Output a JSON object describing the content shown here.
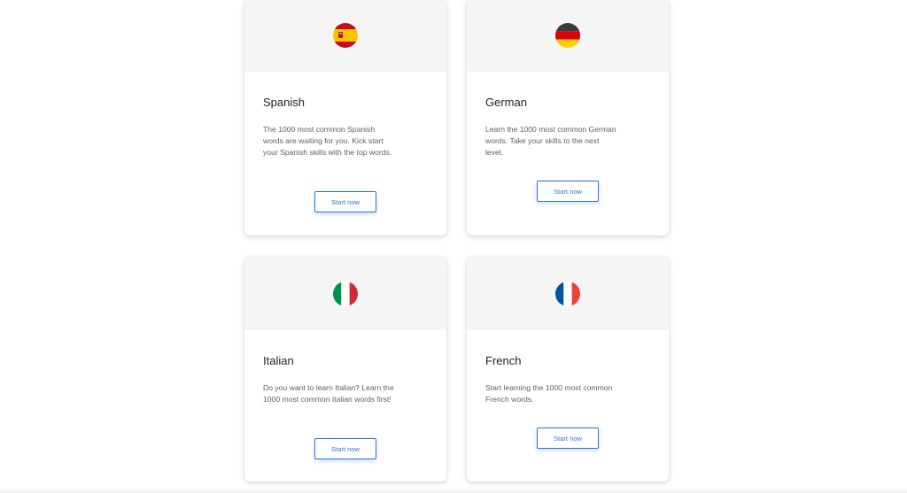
{
  "cards": [
    {
      "id": "spanish",
      "title": "Spanish",
      "description": "The 1000 most common Spanish words are waiting for you. Kick start your Spanish skills with the top words.",
      "button_label": "Start now",
      "flag_icon": "spain-flag-icon"
    },
    {
      "id": "german",
      "title": "German",
      "description": "Learn the 1000 most common German words. Take your skills to the next level.",
      "button_label": "Start now",
      "flag_icon": "germany-flag-icon"
    },
    {
      "id": "italian",
      "title": "Italian",
      "description": "Do you want to learn Italian? Learn the 1000 most common Italian words first!",
      "button_label": "Start now",
      "flag_icon": "italy-flag-icon"
    },
    {
      "id": "french",
      "title": "French",
      "description": "Start learning the 1000 most common French words.",
      "button_label": "Start now",
      "flag_icon": "france-flag-icon"
    }
  ],
  "colors": {
    "accent": "#2f73d6",
    "card_header_bg": "#f5f5f5",
    "title_text": "#222222",
    "body_text": "#5f5f5f"
  }
}
